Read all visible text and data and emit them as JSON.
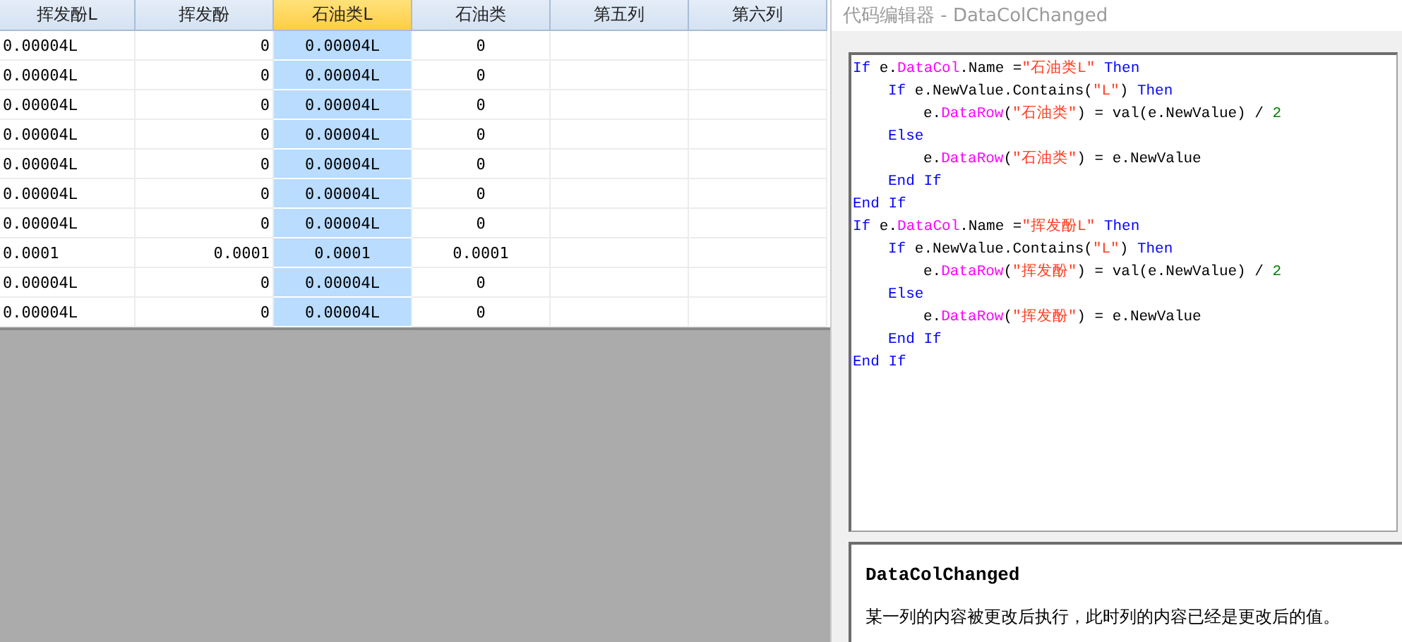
{
  "table": {
    "columns": [
      {
        "label": "挥发酚L",
        "selected": false
      },
      {
        "label": "挥发酚",
        "selected": false
      },
      {
        "label": "石油类L",
        "selected": true
      },
      {
        "label": "石油类",
        "selected": false
      },
      {
        "label": "第五列",
        "selected": false
      },
      {
        "label": "第六列",
        "selected": false
      }
    ],
    "rows": [
      [
        "0.00004L",
        "0",
        "0.00004L",
        "0"
      ],
      [
        "0.00004L",
        "0",
        "0.00004L",
        "0"
      ],
      [
        "0.00004L",
        "0",
        "0.00004L",
        "0"
      ],
      [
        "0.00004L",
        "0",
        "0.00004L",
        "0"
      ],
      [
        "0.00004L",
        "0",
        "0.00004L",
        "0"
      ],
      [
        "0.00004L",
        "0",
        "0.00004L",
        "0"
      ],
      [
        "0.00004L",
        "0",
        "0.00004L",
        "0"
      ],
      [
        "0.0001",
        "0.0001",
        "0.0001",
        "0.0001"
      ],
      [
        "0.00004L",
        "0",
        "0.00004L",
        "0"
      ],
      [
        "0.00004L",
        "0",
        "0.00004L",
        "0"
      ]
    ]
  },
  "editor": {
    "title": "代码编辑器 - DataColChanged",
    "code": [
      {
        "tokens": [
          {
            "kind": "keyword",
            "text": "If"
          },
          {
            "kind": "plain",
            "text": " e."
          },
          {
            "kind": "member",
            "text": "DataCol"
          },
          {
            "kind": "plain",
            "text": ".Name ="
          },
          {
            "kind": "string",
            "text": "\"石油类L\""
          },
          {
            "kind": "keyword",
            "text": " Then"
          }
        ],
        "children": [
          {
            "tokens": [
              {
                "kind": "keyword",
                "text": "If"
              },
              {
                "kind": "plain",
                "text": " e.NewValue.Contains("
              },
              {
                "kind": "string",
                "text": "\"L\""
              },
              {
                "kind": "plain",
                "text": ") "
              },
              {
                "kind": "keyword",
                "text": "Then"
              }
            ],
            "children": [
              {
                "tokens": [
                  {
                    "kind": "plain",
                    "text": "e."
                  },
                  {
                    "kind": "member",
                    "text": "DataRow"
                  },
                  {
                    "kind": "plain",
                    "text": "("
                  },
                  {
                    "kind": "string",
                    "text": "\"石油类\""
                  },
                  {
                    "kind": "plain",
                    "text": ") = val(e.NewValue) / "
                  },
                  {
                    "kind": "number",
                    "text": "2"
                  }
                ]
              }
            ]
          },
          {
            "tokens": [
              {
                "kind": "keyword",
                "text": "Else"
              }
            ],
            "children": [
              {
                "tokens": [
                  {
                    "kind": "plain",
                    "text": "e."
                  },
                  {
                    "kind": "member",
                    "text": "DataRow"
                  },
                  {
                    "kind": "plain",
                    "text": "("
                  },
                  {
                    "kind": "string",
                    "text": "\"石油类\""
                  },
                  {
                    "kind": "plain",
                    "text": ") = e.NewValue"
                  }
                ]
              }
            ]
          },
          {
            "tokens": [
              {
                "kind": "keyword",
                "text": "End If"
              }
            ]
          }
        ]
      },
      {
        "tokens": [
          {
            "kind": "keyword",
            "text": "End If"
          }
        ]
      },
      {
        "tokens": [
          {
            "kind": "keyword",
            "text": "If"
          },
          {
            "kind": "plain",
            "text": " e."
          },
          {
            "kind": "member",
            "text": "DataCol"
          },
          {
            "kind": "plain",
            "text": ".Name ="
          },
          {
            "kind": "string",
            "text": "\"挥发酚L\""
          },
          {
            "kind": "keyword",
            "text": " Then"
          }
        ],
        "children": [
          {
            "tokens": [
              {
                "kind": "keyword",
                "text": "If"
              },
              {
                "kind": "plain",
                "text": " e.NewValue.Contains("
              },
              {
                "kind": "string",
                "text": "\"L\""
              },
              {
                "kind": "plain",
                "text": ") "
              },
              {
                "kind": "keyword",
                "text": "Then"
              }
            ],
            "children": [
              {
                "tokens": [
                  {
                    "kind": "plain",
                    "text": "e."
                  },
                  {
                    "kind": "member",
                    "text": "DataRow"
                  },
                  {
                    "kind": "plain",
                    "text": "("
                  },
                  {
                    "kind": "string",
                    "text": "\"挥发酚\""
                  },
                  {
                    "kind": "plain",
                    "text": ") = val(e.NewValue) / "
                  },
                  {
                    "kind": "number",
                    "text": "2"
                  }
                ]
              }
            ]
          },
          {
            "tokens": [
              {
                "kind": "keyword",
                "text": "Else"
              }
            ],
            "children": [
              {
                "tokens": [
                  {
                    "kind": "plain",
                    "text": "e."
                  },
                  {
                    "kind": "member",
                    "text": "DataRow"
                  },
                  {
                    "kind": "plain",
                    "text": "("
                  },
                  {
                    "kind": "string",
                    "text": "\"挥发酚\""
                  },
                  {
                    "kind": "plain",
                    "text": ") = e.NewValue"
                  }
                ]
              }
            ]
          },
          {
            "tokens": [
              {
                "kind": "keyword",
                "text": "End If"
              }
            ]
          }
        ]
      },
      {
        "tokens": [
          {
            "kind": "keyword",
            "text": "End If"
          }
        ]
      }
    ]
  },
  "help": {
    "title": "DataColChanged",
    "text": "某一列的内容被更改后执行，此时列的内容已经是更改后的值。"
  }
}
